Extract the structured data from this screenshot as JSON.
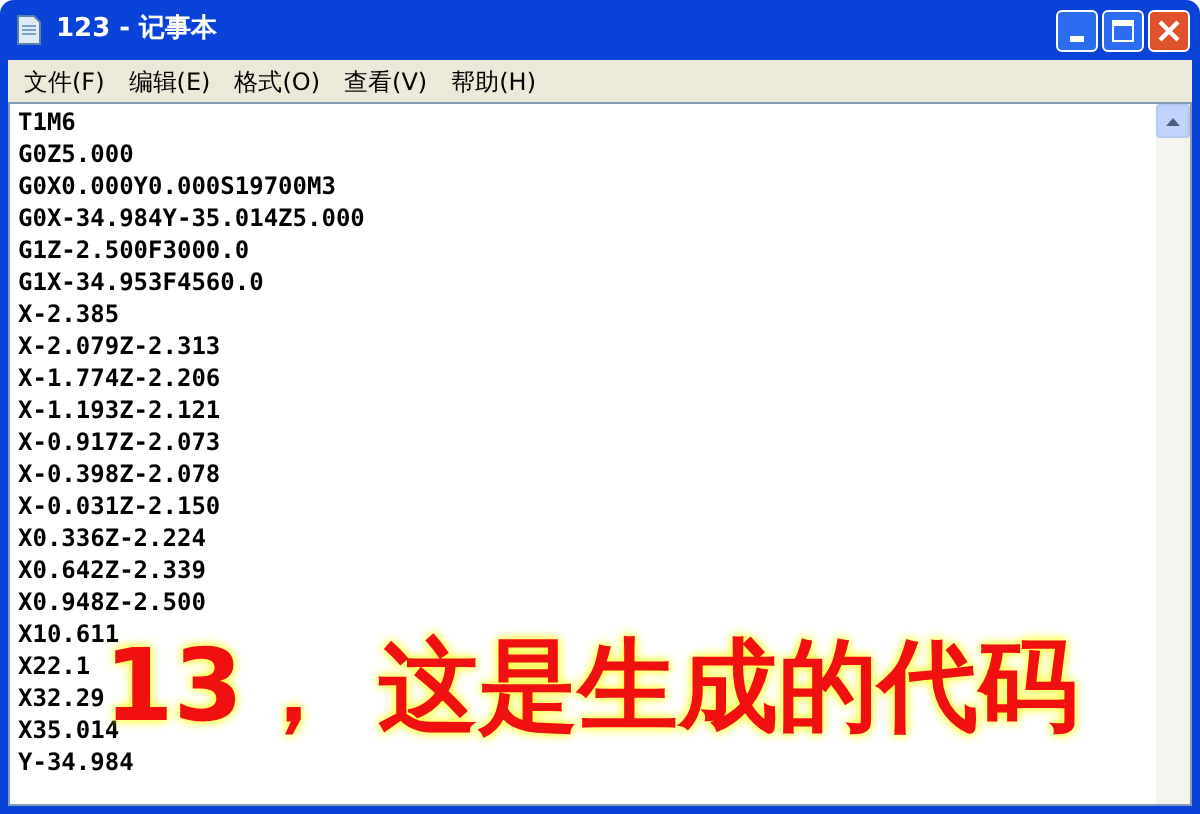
{
  "window": {
    "title": "123 - 记事本"
  },
  "menu": [
    "文件(F)",
    "编辑(E)",
    "格式(O)",
    "查看(V)",
    "帮助(H)"
  ],
  "lines": [
    "T1M6",
    "G0Z5.000",
    "G0X0.000Y0.000S19700M3",
    "G0X-34.984Y-35.014Z5.000",
    "G1Z-2.500F3000.0",
    "G1X-34.953F4560.0",
    "X-2.385",
    "X-2.079Z-2.313",
    "X-1.774Z-2.206",
    "X-1.193Z-2.121",
    "X-0.917Z-2.073",
    "X-0.398Z-2.078",
    "X-0.031Z-2.150",
    "X0.336Z-2.224",
    "X0.642Z-2.339",
    "X0.948Z-2.500",
    "X10.611",
    "X22.1",
    "X32.29",
    "X35.014",
    "Y-34.984"
  ],
  "caption": "13， 这是生成的代码"
}
